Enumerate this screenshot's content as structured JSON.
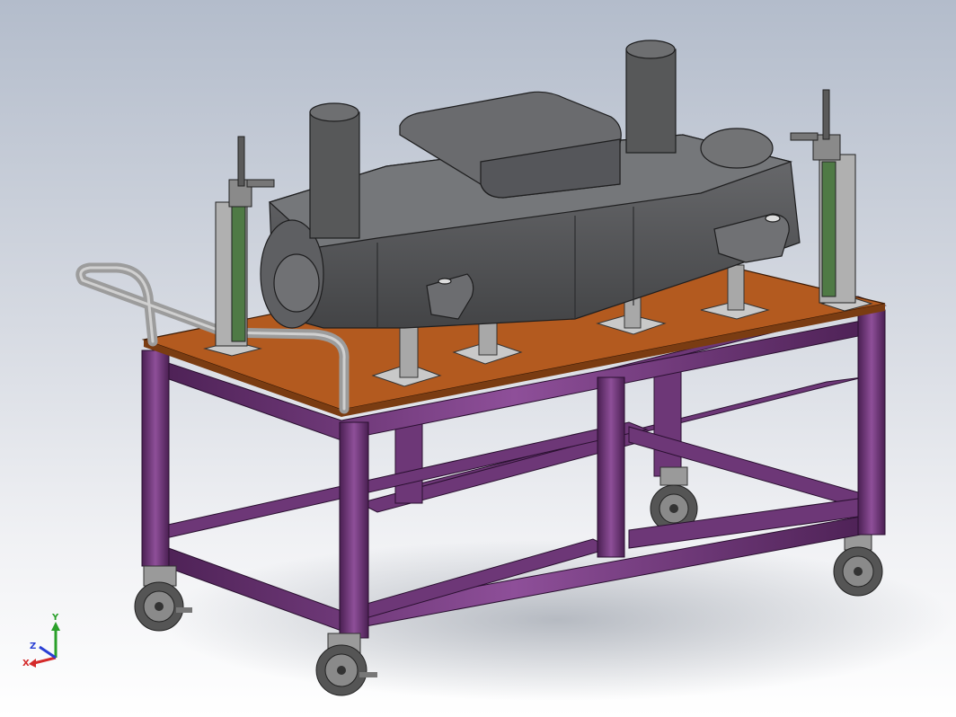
{
  "viewport": {
    "background_top": "#b3bccb",
    "background_bottom": "#ffffff"
  },
  "model": {
    "frame_color": "#7a3d84",
    "table_top_color": "#b35a1f",
    "housing_color": "#5b5c5e",
    "clamp_post_color": "#4f7a45"
  },
  "triad": {
    "x_label": "X",
    "y_label": "Y",
    "z_label": "Z",
    "x_color": "#d42a2a",
    "y_color": "#2aa02a",
    "z_color": "#2a3fd4"
  }
}
